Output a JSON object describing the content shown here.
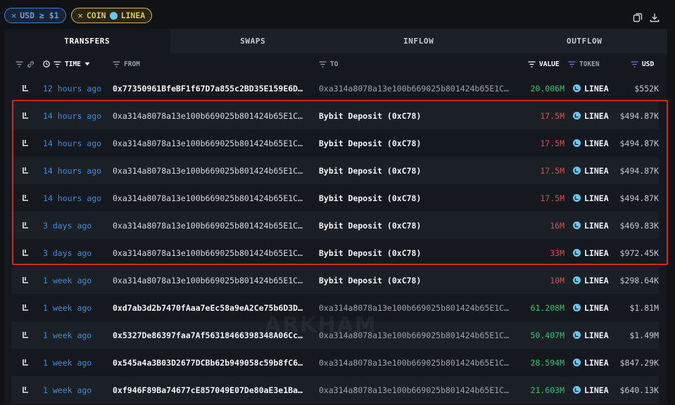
{
  "filters": [
    {
      "label": "USD ≥ $1",
      "kind": "usd"
    },
    {
      "label": "COIN",
      "coin": "LINEA",
      "kind": "coin"
    }
  ],
  "tabs": [
    {
      "label": "TRANSFERS",
      "active": true
    },
    {
      "label": "SWAPS",
      "active": false
    },
    {
      "label": "INFLOW",
      "active": false
    },
    {
      "label": "OUTFLOW",
      "active": false
    }
  ],
  "columns": {
    "time": "TIME",
    "from": "FROM",
    "to": "TO",
    "value": "VALUE",
    "token": "TOKEN",
    "usd": "USD"
  },
  "watermark": "ARKHAM",
  "colors": {
    "accent_blue": "#3f8bdc",
    "positive": "#2fc473",
    "negative": "#e34a4a",
    "highlight": "#e01e1e",
    "coin_yellow": "#e6c74e"
  },
  "rows": [
    {
      "time": "12 hours ago",
      "from": "0x77350961BfeBF1f67D7a855c2BD35E159E6D…",
      "to": "0xa314a8078a13e100b669025b801424b65E1C…",
      "value": "20.006M",
      "direction": "in",
      "token": "LINEA",
      "usd": "$552K"
    },
    {
      "time": "14 hours ago",
      "from": "0xa314a8078a13e100b669025b801424b65E1C…",
      "to": "Bybit Deposit (0xC78)",
      "value": "17.5M",
      "direction": "out",
      "token": "LINEA",
      "usd": "$494.87K"
    },
    {
      "time": "14 hours ago",
      "from": "0xa314a8078a13e100b669025b801424b65E1C…",
      "to": "Bybit Deposit (0xC78)",
      "value": "17.5M",
      "direction": "out",
      "token": "LINEA",
      "usd": "$494.87K"
    },
    {
      "time": "14 hours ago",
      "from": "0xa314a8078a13e100b669025b801424b65E1C…",
      "to": "Bybit Deposit (0xC78)",
      "value": "17.5M",
      "direction": "out",
      "token": "LINEA",
      "usd": "$494.87K"
    },
    {
      "time": "14 hours ago",
      "from": "0xa314a8078a13e100b669025b801424b65E1C…",
      "to": "Bybit Deposit (0xC78)",
      "value": "17.5M",
      "direction": "out",
      "token": "LINEA",
      "usd": "$494.87K"
    },
    {
      "time": "3 days ago",
      "from": "0xa314a8078a13e100b669025b801424b65E1C…",
      "to": "Bybit Deposit (0xC78)",
      "value": "16M",
      "direction": "out",
      "token": "LINEA",
      "usd": "$469.83K"
    },
    {
      "time": "3 days ago",
      "from": "0xa314a8078a13e100b669025b801424b65E1C…",
      "to": "Bybit Deposit (0xC78)",
      "value": "33M",
      "direction": "out",
      "token": "LINEA",
      "usd": "$972.45K"
    },
    {
      "time": "1 week ago",
      "from": "0xa314a8078a13e100b669025b801424b65E1C…",
      "to": "Bybit Deposit (0xC78)",
      "value": "10M",
      "direction": "out",
      "token": "LINEA",
      "usd": "$298.64K"
    },
    {
      "time": "1 week ago",
      "from": "0xd7ab3d2b7470fAaa7eEc58a9eA2Ce75b6D3D…",
      "to": "0xa314a8078a13e100b669025b801424b65E1C…",
      "value": "61.208M",
      "direction": "in",
      "token": "LINEA",
      "usd": "$1.81M"
    },
    {
      "time": "1 week ago",
      "from": "0x5327De86397faa7Af56318466398348A06Cc…",
      "to": "0xa314a8078a13e100b669025b801424b65E1C…",
      "value": "50.407M",
      "direction": "in",
      "token": "LINEA",
      "usd": "$1.49M"
    },
    {
      "time": "1 week ago",
      "from": "0x545a4a3B03D2677DCBb62b949058c59b8fC6…",
      "to": "0xa314a8078a13e100b669025b801424b65E1C…",
      "value": "28.594M",
      "direction": "in",
      "token": "LINEA",
      "usd": "$847.29K"
    },
    {
      "time": "1 week ago",
      "from": "0xf946F89Ba74677cE857049E07De80aE3e1Ba…",
      "to": "0xa314a8078a13e100b669025b801424b65E1C…",
      "value": "21.603M",
      "direction": "in",
      "token": "LINEA",
      "usd": "$640.13K"
    }
  ]
}
